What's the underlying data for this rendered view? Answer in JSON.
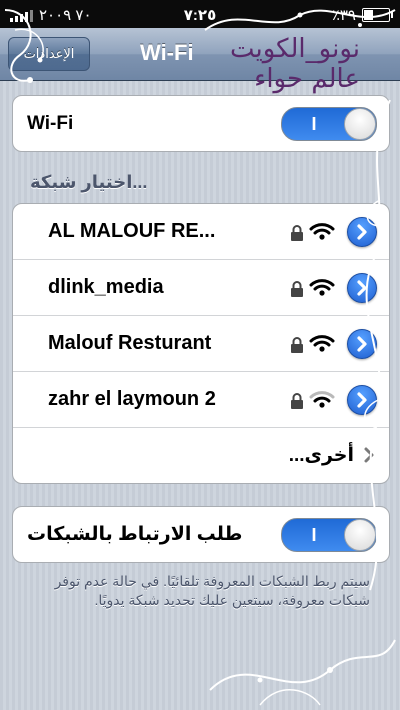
{
  "status_bar": {
    "carrier": "٧٠ ٢٠٠٩",
    "time": "٧:٢٥",
    "battery_percent_text": "٪٣٩",
    "battery_level": 0.39
  },
  "nav": {
    "back_label": "الإعدادات",
    "title": "Wi-Fi"
  },
  "watermark": {
    "line1": "نونو_الكويت",
    "line2": "عالم حواء"
  },
  "wifi_toggle": {
    "label": "Wi-Fi",
    "state_text": "I",
    "on": true
  },
  "networks_header": "اختيار شبكة...",
  "networks": [
    {
      "name": "AL MALOUF RE...",
      "locked": true,
      "signal": 3
    },
    {
      "name": "dlink_media",
      "locked": true,
      "signal": 3
    },
    {
      "name": "Malouf Resturant",
      "locked": true,
      "signal": 3
    },
    {
      "name": "zahr el laymoun 2",
      "locked": true,
      "signal": 2
    }
  ],
  "other_label": "أخرى...",
  "ask_join": {
    "label": "طلب الارتباط بالشبكات",
    "state_text": "I",
    "on": true
  },
  "footer_note": "سيتم ربط الشبكات المعروفة تلقائيًا. في حالة عدم توفر شبكات معروفة، سيتعين عليك تحديد شبكة يدويًا.",
  "colors": {
    "toggle_on": "#2f7ae5",
    "nav_bar": "#7f94b1",
    "detail_button": "#1f5fd0"
  }
}
